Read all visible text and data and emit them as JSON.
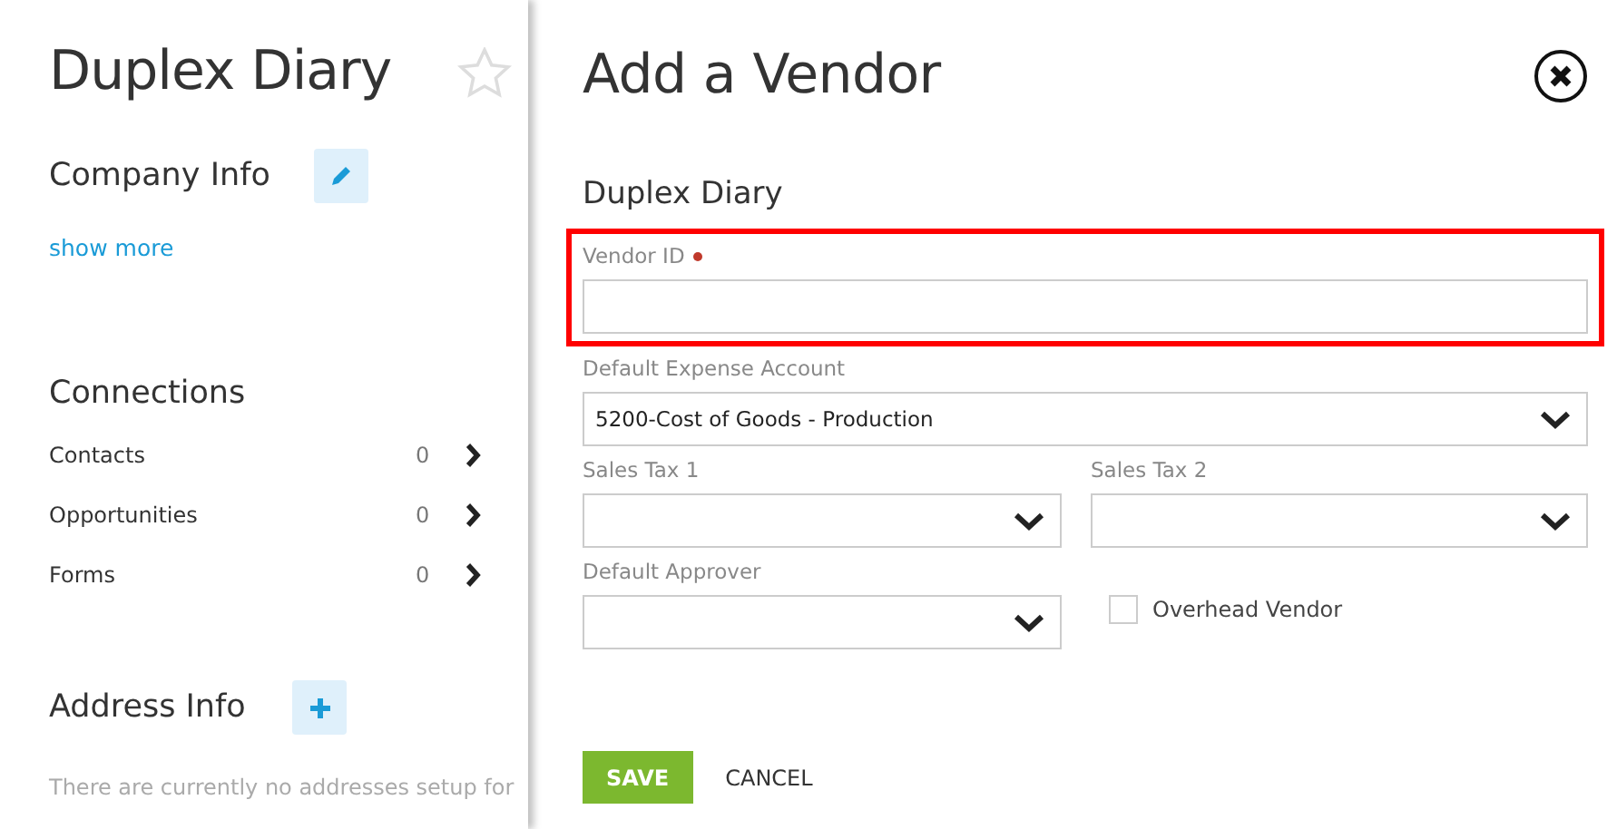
{
  "sidebar": {
    "title": "Duplex Diary",
    "starred": false,
    "company_info": {
      "heading": "Company Info",
      "link": "show more"
    },
    "connections": {
      "heading": "Connections",
      "items": [
        {
          "label": "Contacts",
          "count": "0"
        },
        {
          "label": "Opportunities",
          "count": "0"
        },
        {
          "label": "Forms",
          "count": "0"
        }
      ]
    },
    "address_info": {
      "heading": "Address Info",
      "note": "There are currently no addresses setup for"
    }
  },
  "dialog": {
    "title": "Add a Vendor",
    "subtitle": "Duplex Diary",
    "rows": [
      [
        {
          "kind": "text",
          "label": "Vendor ID",
          "required": true,
          "highlighted": true
        }
      ],
      [
        {
          "kind": "select",
          "label": "Default Expense Account",
          "value": "5200-Cost of Goods - Production"
        }
      ],
      [
        {
          "kind": "select",
          "label": "Sales Tax 1"
        },
        {
          "kind": "select",
          "label": "Sales Tax 2"
        }
      ],
      [
        {
          "kind": "select",
          "label": "Default Approver"
        },
        {
          "kind": "checkbox",
          "label": "Overhead Vendor",
          "checked": false
        }
      ]
    ],
    "buttons": [
      {
        "label": "SAVE",
        "kind": "primary"
      },
      {
        "label": "CANCEL",
        "kind": "plain"
      }
    ]
  }
}
